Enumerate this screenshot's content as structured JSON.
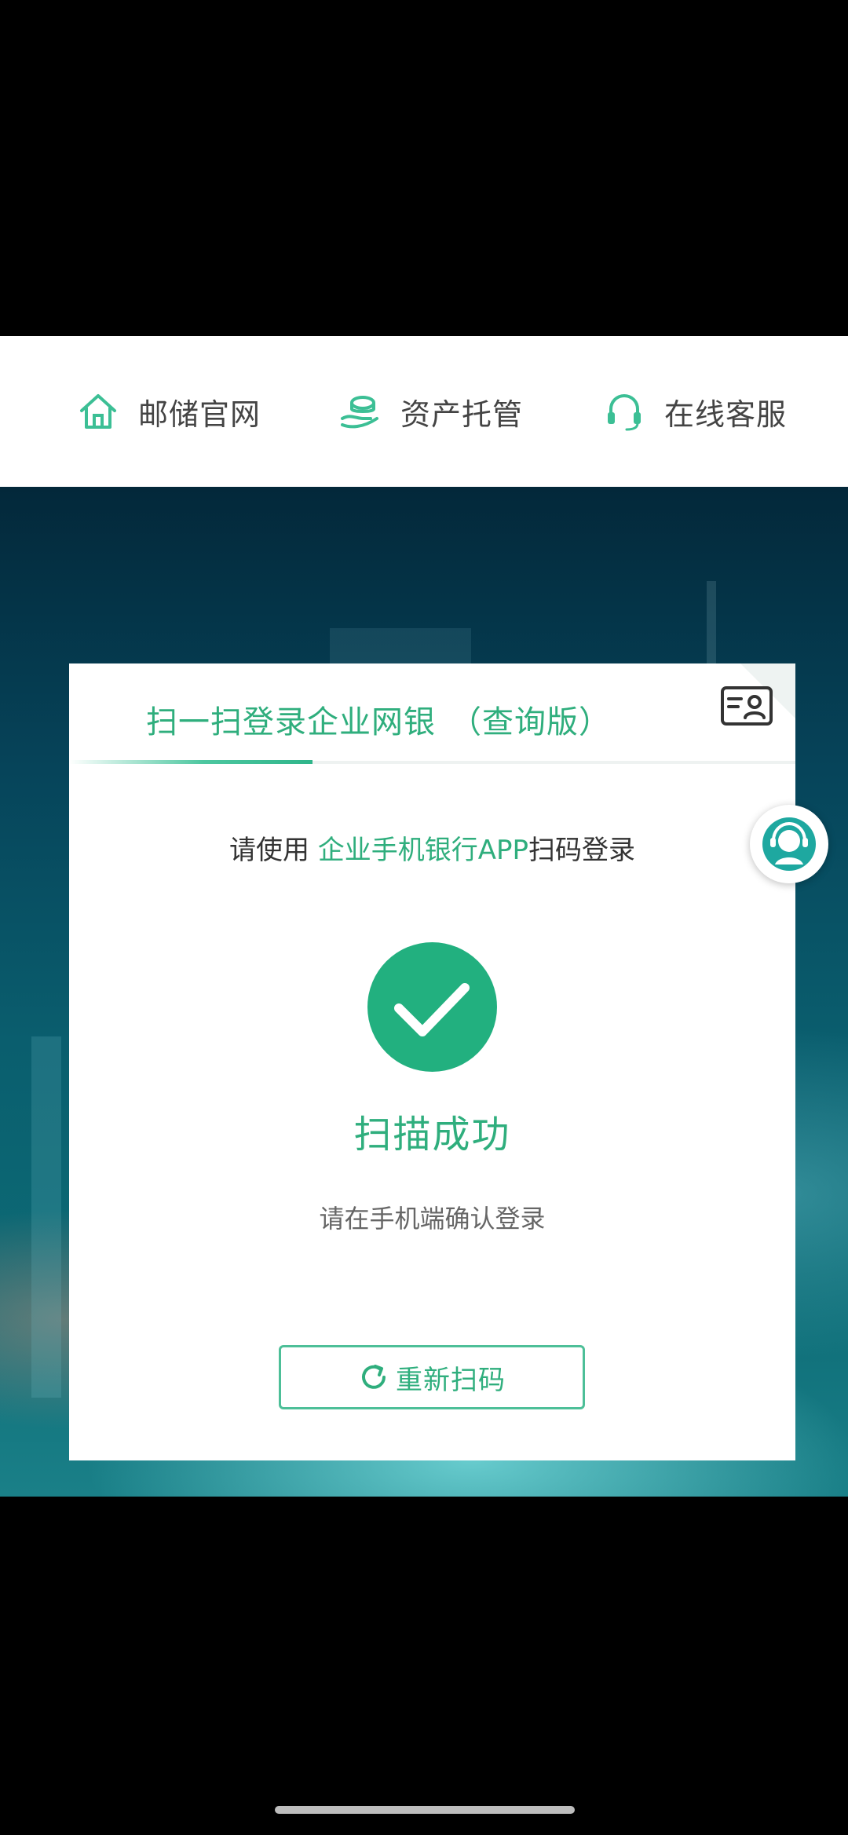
{
  "nav": {
    "items": [
      {
        "label": "邮储官网",
        "icon": "home-icon"
      },
      {
        "label": "资产托管",
        "icon": "asset-custody-icon"
      },
      {
        "label": "在线客服",
        "icon": "headset-icon"
      }
    ]
  },
  "card": {
    "title": "扫一扫登录企业网银",
    "title_suffix": "（查询版）",
    "hint_prefix": "请使用",
    "hint_accent": "企业手机银行APP",
    "hint_suffix": "扫码登录",
    "status_title": "扫描成功",
    "status_subtitle": "请在手机端确认登录",
    "rescan_label": "重新扫码"
  },
  "colors": {
    "accent": "#2fae7d",
    "nav_icon": "#3cbf95",
    "background": "#06445a"
  }
}
